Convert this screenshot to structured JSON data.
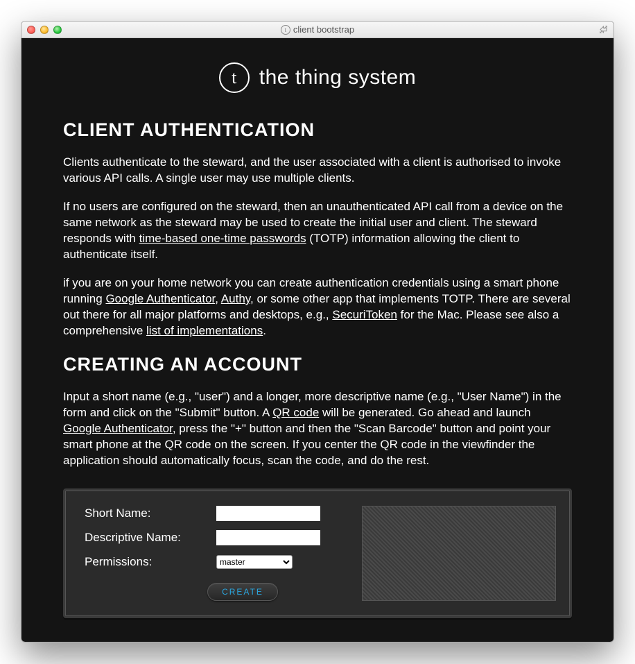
{
  "window": {
    "title": "client bootstrap",
    "icon_letter": "t"
  },
  "logo": {
    "letter": "t",
    "text": "the thing system"
  },
  "section1": {
    "heading": "CLIENT AUTHENTICATION",
    "p1": "Clients authenticate to the steward, and the user associated with a client is authorised to invoke various API calls. A single user may use multiple clients.",
    "p2a": "If no users are configured on the steward, then an unauthenticated API call from a device on the same network as the steward may be used to create the initial user and client. The steward responds with ",
    "p2_link": "time-based one-time passwords",
    "p2b": " (TOTP) information allowing the client to authenticate itself.",
    "p3a": "if you are on your home network you can create authentication credentials using a smart phone running ",
    "p3_link1": "Google Authenticator",
    "p3b": ", ",
    "p3_link2": "Authy",
    "p3c": ", or some other app that implements TOTP. There are several out there for all major platforms and desktops, e.g., ",
    "p3_link3": "SecuriToken",
    "p3d": " for the Mac. Please see also a comprehensive ",
    "p3_link4": "list of implementations",
    "p3e": "."
  },
  "section2": {
    "heading": "CREATING AN ACCOUNT",
    "p1a": "Input a short name (e.g., \"user\") and a longer, more descriptive name (e.g., \"User Name\") in the form and click on the \"Submit\" button. A ",
    "p1_link1": "QR code",
    "p1b": " will be generated. Go ahead and launch ",
    "p1_link2": "Google Authenticator",
    "p1c": ", press the \"+\" button and then the \"Scan Barcode\" button and point your smart phone at the QR code on the screen. If you center the QR code in the viewfinder the application should automatically focus, scan the code, and do the rest."
  },
  "form": {
    "short_name_label": "Short Name:",
    "descriptive_name_label": "Descriptive Name:",
    "permissions_label": "Permissions:",
    "permissions_value": "master",
    "create_label": "CREATE"
  }
}
